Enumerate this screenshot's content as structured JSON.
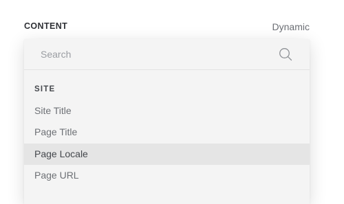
{
  "header": {
    "content_label": "CONTENT",
    "mode_label": "Dynamic"
  },
  "dropdown": {
    "search": {
      "placeholder": "Search",
      "value": "",
      "icon": "search-icon"
    },
    "section_heading": "SITE",
    "items": [
      {
        "label": "Site Title",
        "highlighted": false
      },
      {
        "label": "Page Title",
        "highlighted": false
      },
      {
        "label": "Page Locale",
        "highlighted": true
      },
      {
        "label": "Page URL",
        "highlighted": false
      }
    ]
  },
  "colors": {
    "panel_bg": "#f4f4f4",
    "highlight_bg": "#e5e5e5",
    "heading_text": "#2f3136",
    "item_text": "#6d7075"
  }
}
